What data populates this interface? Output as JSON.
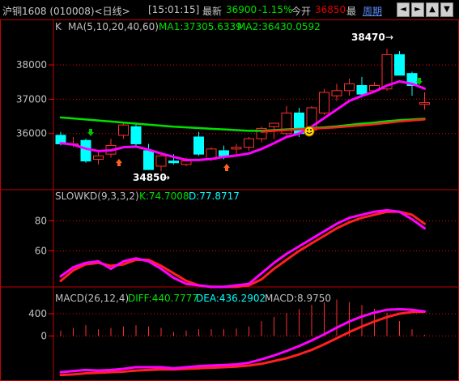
{
  "header": {
    "title": "沪铜1608 (010008)<日线>",
    "time": "[15:01:15]",
    "last_label": "最新",
    "last_value": "36900",
    "change": "-1.15%",
    "open_label": "今开",
    "open_value": "36850",
    "high_label": "最",
    "period_label": "周期",
    "nav_buttons": [
      "◄",
      "►",
      "▲",
      "▼"
    ]
  },
  "colors": {
    "up": "#ff3030",
    "down": "#00ffff",
    "ma1": "#ff00ff",
    "ma2": "#00e000",
    "ma3": "#ff2020",
    "kline": "#ff00ff",
    "dline": "#00ff00",
    "grid": "#ff0000"
  },
  "price_panel": {
    "legend_k": "K",
    "legend_ma": "MA(5,10,20,40,60)",
    "ma1_text": "MA1:37305.6339",
    "ma2_text": "MA2:36430.0592",
    "yticks": [
      38000,
      37000,
      36000
    ],
    "ylim": [
      34600,
      38900
    ],
    "high_annotation": "38470",
    "low_annotation": "34850"
  },
  "kd_panel": {
    "legend": "SLOWKD(9,3,3,2)",
    "k_text": "K:74.7008",
    "d_text": "D:77.8717",
    "yticks": [
      80,
      60
    ],
    "ylim": [
      37,
      91
    ]
  },
  "macd_panel": {
    "legend": "MACD(26,12,4)",
    "diff_text": "DIFF:440.7777",
    "dea_text": "DEA:436.2902",
    "macd_text": "MACD:8.9750",
    "yticks": [
      400,
      0
    ],
    "ylim": [
      -750,
      560
    ]
  },
  "chart_data": {
    "type": "candlestick",
    "candles": [
      {
        "o": 35950,
        "h": 36050,
        "l": 35650,
        "c": 35700
      },
      {
        "o": 35700,
        "h": 35900,
        "l": 35600,
        "c": 35700
      },
      {
        "o": 35800,
        "h": 35850,
        "l": 35150,
        "c": 35200
      },
      {
        "o": 35250,
        "h": 35450,
        "l": 35100,
        "c": 35350
      },
      {
        "o": 35400,
        "h": 35850,
        "l": 35300,
        "c": 35650
      },
      {
        "o": 35950,
        "h": 36300,
        "l": 35850,
        "c": 36250
      },
      {
        "o": 36200,
        "h": 36300,
        "l": 35650,
        "c": 35700
      },
      {
        "o": 35500,
        "h": 35700,
        "l": 34950,
        "c": 34950
      },
      {
        "o": 35050,
        "h": 35400,
        "l": 34900,
        "c": 35350
      },
      {
        "o": 35200,
        "h": 35400,
        "l": 35100,
        "c": 35150
      },
      {
        "o": 35100,
        "h": 35300,
        "l": 35050,
        "c": 35200
      },
      {
        "o": 35900,
        "h": 36050,
        "l": 35350,
        "c": 35400
      },
      {
        "o": 35250,
        "h": 35600,
        "l": 35200,
        "c": 35550
      },
      {
        "o": 35500,
        "h": 35650,
        "l": 35250,
        "c": 35350
      },
      {
        "o": 35550,
        "h": 35700,
        "l": 35400,
        "c": 35600
      },
      {
        "o": 35600,
        "h": 35900,
        "l": 35500,
        "c": 35850
      },
      {
        "o": 35850,
        "h": 36200,
        "l": 35750,
        "c": 36150
      },
      {
        "o": 36200,
        "h": 36300,
        "l": 35850,
        "c": 36300
      },
      {
        "o": 36000,
        "h": 36800,
        "l": 35900,
        "c": 36600
      },
      {
        "o": 36600,
        "h": 36750,
        "l": 35900,
        "c": 36000
      },
      {
        "o": 36100,
        "h": 36800,
        "l": 36050,
        "c": 36750
      },
      {
        "o": 36600,
        "h": 37300,
        "l": 36550,
        "c": 37200
      },
      {
        "o": 37100,
        "h": 37450,
        "l": 36950,
        "c": 37250
      },
      {
        "o": 37250,
        "h": 37600,
        "l": 37100,
        "c": 37450
      },
      {
        "o": 37400,
        "h": 37650,
        "l": 37050,
        "c": 37150
      },
      {
        "o": 37250,
        "h": 37500,
        "l": 37200,
        "c": 37400
      },
      {
        "o": 37300,
        "h": 38470,
        "l": 37250,
        "c": 38300
      },
      {
        "o": 38300,
        "h": 38400,
        "l": 37700,
        "c": 37700
      },
      {
        "o": 37750,
        "h": 37800,
        "l": 37100,
        "c": 37400
      },
      {
        "o": 36850,
        "h": 37200,
        "l": 36700,
        "c": 36900
      }
    ],
    "ma1": [
      35720,
      35680,
      35560,
      35490,
      35510,
      35600,
      35620,
      35530,
      35420,
      35320,
      35230,
      35230,
      35260,
      35320,
      35360,
      35420,
      35550,
      35720,
      35900,
      36000,
      36200,
      36450,
      36700,
      36950,
      37100,
      37220,
      37400,
      37520,
      37450,
      37310
    ],
    "ma2": [
      36470,
      36440,
      36410,
      36380,
      36350,
      36320,
      36290,
      36260,
      36230,
      36200,
      36180,
      36160,
      36140,
      36120,
      36100,
      36080,
      36080,
      36100,
      36120,
      36140,
      36160,
      36180,
      36210,
      36250,
      36290,
      36320,
      36360,
      36390,
      36410,
      36430
    ],
    "ma3": [
      null,
      null,
      null,
      null,
      null,
      null,
      null,
      null,
      null,
      null,
      null,
      null,
      null,
      null,
      null,
      null,
      36050,
      36080,
      36100,
      36120,
      36140,
      36160,
      36180,
      36210,
      36240,
      36270,
      36310,
      36350,
      36380,
      36410
    ],
    "k": [
      43,
      49,
      52,
      53,
      48,
      53,
      55,
      53,
      48,
      42,
      38,
      37,
      36,
      36,
      37,
      38,
      45,
      52,
      58,
      63,
      68,
      73,
      78,
      82,
      84,
      86,
      87,
      86,
      81,
      75
    ],
    "d": [
      40,
      47,
      51,
      52,
      50,
      51,
      54,
      54,
      50,
      45,
      40,
      37,
      36,
      36,
      36,
      37,
      41,
      48,
      54,
      60,
      65,
      70,
      75,
      79,
      82,
      84,
      86,
      86,
      84,
      78
    ],
    "diff": [
      -650,
      -630,
      -610,
      -620,
      -610,
      -590,
      -560,
      -560,
      -560,
      -580,
      -560,
      -540,
      -530,
      -520,
      -510,
      -480,
      -420,
      -350,
      -270,
      -180,
      -80,
      30,
      150,
      260,
      350,
      420,
      470,
      480,
      470,
      441
    ],
    "dea": [
      -700,
      -690,
      -670,
      -660,
      -650,
      -640,
      -620,
      -610,
      -600,
      -600,
      -590,
      -580,
      -570,
      -560,
      -550,
      -530,
      -500,
      -450,
      -400,
      -330,
      -250,
      -150,
      -40,
      70,
      170,
      260,
      340,
      400,
      430,
      436
    ],
    "macd": [
      40,
      60,
      80,
      50,
      60,
      70,
      80,
      70,
      60,
      30,
      40,
      50,
      50,
      50,
      55,
      70,
      110,
      140,
      170,
      200,
      230,
      250,
      270,
      250,
      230,
      200,
      170,
      110,
      50,
      9
    ]
  }
}
